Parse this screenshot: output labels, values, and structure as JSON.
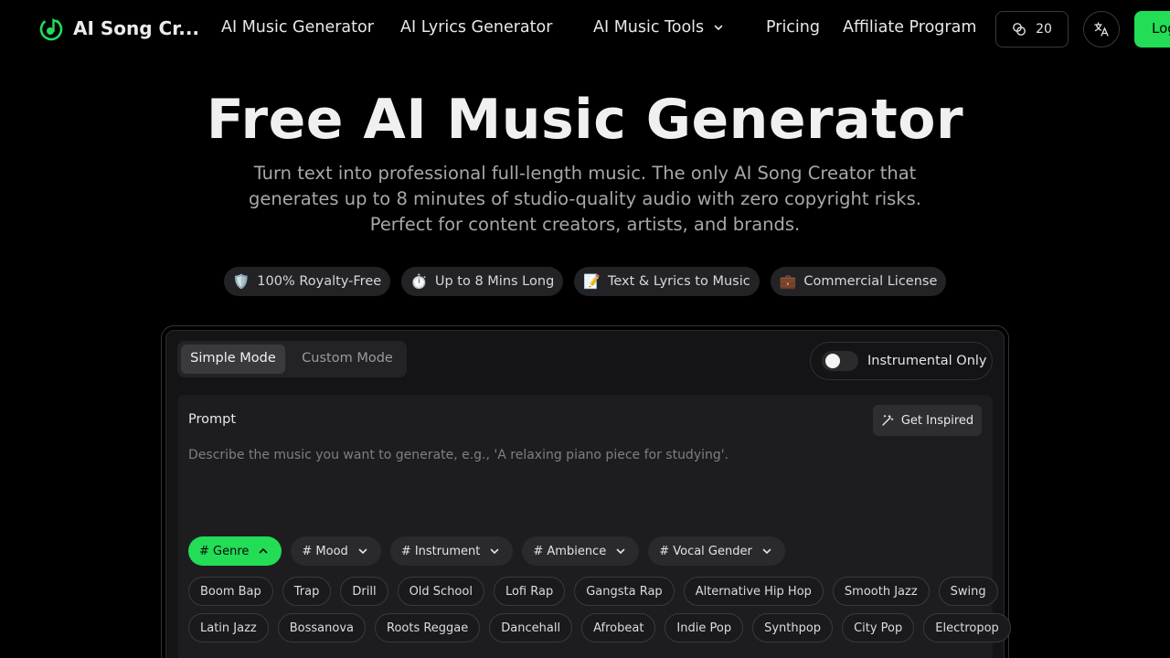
{
  "nav": {
    "logo_text": "AI Song Cr...",
    "links": [
      "AI Music Generator",
      "AI Lyrics Generator",
      "AI Music Tools",
      "Pricing",
      "Affiliate Program"
    ],
    "credits": "20",
    "login_label": "Log"
  },
  "hero": {
    "title": "Free AI Music Generator",
    "subtitle": "Turn text into professional full-length music. The only AI Song Creator that generates up to 8 minutes of studio-quality audio with zero copyright risks. Perfect for content creators, artists, and brands.",
    "badges": [
      {
        "icon": "🛡️",
        "label": "100% Royalty-Free"
      },
      {
        "icon": "⏱️",
        "label": "Up to 8 Mins Long"
      },
      {
        "icon": "📝",
        "label": "Text & Lyrics to Music"
      },
      {
        "icon": "💼",
        "label": "Commercial License"
      }
    ]
  },
  "generator": {
    "modes": [
      "Simple Mode",
      "Custom Mode"
    ],
    "active_mode": "Simple Mode",
    "instrumental_label": "Instrumental Only",
    "instrumental_on": false,
    "prompt_label": "Prompt",
    "inspire_label": "Get Inspired",
    "prompt_placeholder": "Describe the music you want to generate, e.g., 'A relaxing piano piece for studying'.",
    "prompt_value": "",
    "categories": [
      "# Genre",
      "# Mood",
      "# Instrument",
      "# Ambience",
      "# Vocal Gender"
    ],
    "active_category": "# Genre",
    "tags_row1": [
      "Boom Bap",
      "Trap",
      "Drill",
      "Old School",
      "Lofi Rap",
      "Gangsta Rap",
      "Alternative Hip Hop",
      "Smooth Jazz",
      "Swing"
    ],
    "tags_row2": [
      "Latin Jazz",
      "Bossanova",
      "Roots Reggae",
      "Dancehall",
      "Afrobeat",
      "Indie Pop",
      "Synthpop",
      "City Pop",
      "Electropop"
    ]
  },
  "colors": {
    "accent": "#22dd55",
    "background": "#000000",
    "card": "#141416"
  },
  "icons": {
    "logo": "music-note-circle-icon",
    "credits": "coins-icon",
    "language": "translate-icon",
    "inspire": "magic-wand-icon"
  }
}
